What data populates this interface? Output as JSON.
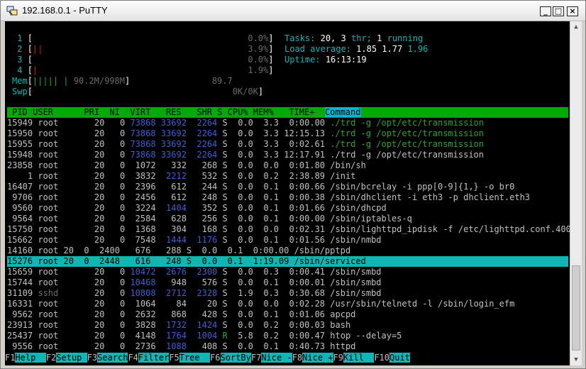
{
  "window": {
    "title": "192.168.0.1 - PuTTY",
    "minimize_glyph": "_",
    "maximize_glyph": "□",
    "close_glyph": "×"
  },
  "meters": {
    "cpus": [
      {
        "id": "1",
        "bar": "",
        "pct": "0.0%"
      },
      {
        "id": "2",
        "bar": "||",
        "pct": "3.9%"
      },
      {
        "id": "3",
        "bar": "",
        "pct": "0.0%"
      },
      {
        "id": "4",
        "bar": "|",
        "pct": "1.9%"
      }
    ],
    "mem": {
      "label": "Mem",
      "bar": "||||| |",
      "text": "90.2M/998M",
      "extra": "89.7"
    },
    "swp": {
      "label": "Swp",
      "text": "0K/0K"
    }
  },
  "summary": {
    "tasks_label": "Tasks:",
    "tasks": "20,",
    "thr": "3",
    "thr_label": "thr;",
    "running": "1",
    "running_label": "running",
    "load_label": "Load average:",
    "load1": "1.85",
    "load5": "1.77",
    "load15": "1.96",
    "uptime_label": "Uptime:",
    "uptime": "16:13:19"
  },
  "table": {
    "header": " PID USER      PRI  NI  VIRT   RES   SHR S CPU% MEM%   TIME+  ",
    "command_header": "Command",
    "rows": [
      {
        "pid": "15949",
        "user": "root",
        "pri": "20",
        "ni": "0",
        "virt": "73868",
        "res": "33692",
        "shr": "2264",
        "s": "S",
        "cpu": "0.0",
        "mem": "3.3",
        "time": "0:00.00",
        "cmd": "./trd -g /opt/etc/transmission",
        "thread": true
      },
      {
        "pid": "15950",
        "user": "root",
        "pri": "20",
        "ni": "0",
        "virt": "73868",
        "res": "33692",
        "shr": "2264",
        "s": "S",
        "cpu": "0.0",
        "mem": "3.3",
        "time": "12:15.13",
        "cmd": "./trd -g /opt/etc/transmission",
        "thread": true
      },
      {
        "pid": "15955",
        "user": "root",
        "pri": "20",
        "ni": "0",
        "virt": "73868",
        "res": "33692",
        "shr": "2264",
        "s": "S",
        "cpu": "0.0",
        "mem": "3.3",
        "time": "0:02.61",
        "cmd": "./trd -g /opt/etc/transmission",
        "thread": true
      },
      {
        "pid": "15948",
        "user": "root",
        "pri": "20",
        "ni": "0",
        "virt": "73868",
        "res": "33692",
        "shr": "2264",
        "s": "S",
        "cpu": "0.0",
        "mem": "3.3",
        "time": "12:17.91",
        "cmd": "./trd -g /opt/etc/transmission",
        "thread": false
      },
      {
        "pid": "23858",
        "user": "root",
        "pri": "20",
        "ni": "0",
        "virt": "1072",
        "res": "332",
        "shr": "268",
        "s": "S",
        "cpu": "0.0",
        "mem": "0.0",
        "time": "0:01.80",
        "cmd": "/bin/sh"
      },
      {
        "pid": "1",
        "user": "root",
        "pri": "20",
        "ni": "0",
        "virt": "3832",
        "res": "2212",
        "shr": "532",
        "s": "S",
        "cpu": "0.0",
        "mem": "0.2",
        "time": "2:38.89",
        "cmd": "/init"
      },
      {
        "pid": "16407",
        "user": "root",
        "pri": "20",
        "ni": "0",
        "virt": "2396",
        "res": "612",
        "shr": "244",
        "s": "S",
        "cpu": "0.0",
        "mem": "0.1",
        "time": "0:00.66",
        "cmd": "/sbin/bcrelay -i ppp[0-9]{1,} -o br0"
      },
      {
        "pid": "9706",
        "user": "root",
        "pri": "20",
        "ni": "0",
        "virt": "2456",
        "res": "612",
        "shr": "248",
        "s": "S",
        "cpu": "0.0",
        "mem": "0.1",
        "time": "0:00.38",
        "cmd": "/sbin/dhclient -i eth3 -p dhclient.eth3"
      },
      {
        "pid": "9560",
        "user": "root",
        "pri": "20",
        "ni": "0",
        "virt": "3224",
        "res": "1404",
        "shr": "352",
        "s": "S",
        "cpu": "0.0",
        "mem": "0.1",
        "time": "0:01.66",
        "cmd": "/sbin/dhcpd"
      },
      {
        "pid": "9564",
        "user": "root",
        "pri": "20",
        "ni": "0",
        "virt": "2584",
        "res": "628",
        "shr": "256",
        "s": "S",
        "cpu": "0.0",
        "mem": "0.1",
        "time": "0:00.00",
        "cmd": "/sbin/iptables-q"
      },
      {
        "pid": "15750",
        "user": "root",
        "pri": "20",
        "ni": "0",
        "virt": "1368",
        "res": "304",
        "shr": "168",
        "s": "S",
        "cpu": "0.0",
        "mem": "0.0",
        "time": "0:02.31",
        "cmd": "/sbin/lighttpd_ipdisk -f /etc/lighttpd.conf.40080"
      },
      {
        "pid": "15662",
        "user": "root",
        "pri": "20",
        "ni": "0",
        "virt": "7548",
        "res": "1444",
        "shr": "1176",
        "s": "S",
        "cpu": "0.0",
        "mem": "0.1",
        "time": "0:01.56",
        "cmd": "/sbin/nmbd"
      },
      {
        "pid": "14160",
        "user": "root",
        "pri": "20",
        "ni": "0",
        "virt": "2400",
        "res": "676",
        "shr": "288",
        "s": "S",
        "cpu": "0.0",
        "mem": "0.1",
        "time": "0:00.00",
        "cmd": "/sbin/pptpd",
        "plain": true
      },
      {
        "pid": "15276",
        "user": "root",
        "pri": "20",
        "ni": "0",
        "virt": "2448",
        "res": "616",
        "shr": "248",
        "s": "S",
        "cpu": "0.0",
        "mem": "0.1",
        "time": "1:19.09",
        "cmd": "/sbin/serviced",
        "selected": true
      },
      {
        "pid": "15659",
        "user": "root",
        "pri": "20",
        "ni": "0",
        "virt": "10472",
        "res": "2676",
        "shr": "2300",
        "s": "S",
        "cpu": "0.0",
        "mem": "0.3",
        "time": "0:00.41",
        "cmd": "/sbin/smbd"
      },
      {
        "pid": "15744",
        "user": "root",
        "pri": "20",
        "ni": "0",
        "virt": "10468",
        "res": "948",
        "shr": "576",
        "s": "S",
        "cpu": "0.0",
        "mem": "0.1",
        "time": "0:00.01",
        "cmd": "/sbin/smbd"
      },
      {
        "pid": "31109",
        "user": "sshd",
        "pri": "20",
        "ni": "0",
        "virt": "10808",
        "res": "2712",
        "shr": "2328",
        "s": "S",
        "cpu": "1.9",
        "mem": "0.3",
        "time": "0:30.68",
        "cmd": "/sbin/smbd",
        "dim_user": true
      },
      {
        "pid": "16331",
        "user": "root",
        "pri": "20",
        "ni": "0",
        "virt": "1064",
        "res": "84",
        "shr": "20",
        "s": "S",
        "cpu": "0.0",
        "mem": "0.0",
        "time": "0:02.28",
        "cmd": "/usr/sbin/telnetd -l /sbin/login_efm"
      },
      {
        "pid": "9562",
        "user": "root",
        "pri": "20",
        "ni": "0",
        "virt": "2632",
        "res": "868",
        "shr": "428",
        "s": "S",
        "cpu": "0.0",
        "mem": "0.1",
        "time": "0:01.06",
        "cmd": "apcpd"
      },
      {
        "pid": "23913",
        "user": "root",
        "pri": "20",
        "ni": "0",
        "virt": "3828",
        "res": "1732",
        "shr": "1424",
        "s": "S",
        "cpu": "0.0",
        "mem": "0.2",
        "time": "0:00.03",
        "cmd": "bash"
      },
      {
        "pid": "25437",
        "user": "root",
        "pri": "20",
        "ni": "0",
        "virt": "4148",
        "res": "1764",
        "shr": "1004",
        "s": "R",
        "cpu": "5.8",
        "mem": "0.2",
        "time": "0:00.47",
        "cmd": "htop --delay=5"
      },
      {
        "pid": "9556",
        "user": "root",
        "pri": "20",
        "ni": "0",
        "virt": "2736",
        "res": "1088",
        "shr": "408",
        "s": "S",
        "cpu": "0.0",
        "mem": "0.1",
        "time": "0:40.73",
        "cmd": "httpd"
      }
    ]
  },
  "fkeys": [
    {
      "key": "F1",
      "label": "Help  "
    },
    {
      "key": "F2",
      "label": "Setup "
    },
    {
      "key": "F3",
      "label": "Search"
    },
    {
      "key": "F4",
      "label": "Filter"
    },
    {
      "key": "F5",
      "label": "Tree  "
    },
    {
      "key": "F6",
      "label": "SortBy"
    },
    {
      "key": "F7",
      "label": "Nice -"
    },
    {
      "key": "F8",
      "label": "Nice +"
    },
    {
      "key": "F9",
      "label": "Kill  "
    },
    {
      "key": "F10",
      "label": "Quit"
    }
  ],
  "colors": {
    "terminal_bg": "#000000",
    "cyan": "#11b5b5",
    "header_green": "#00aa00",
    "command_header": "#00b4d2",
    "thread_green": "#2aa52a"
  }
}
